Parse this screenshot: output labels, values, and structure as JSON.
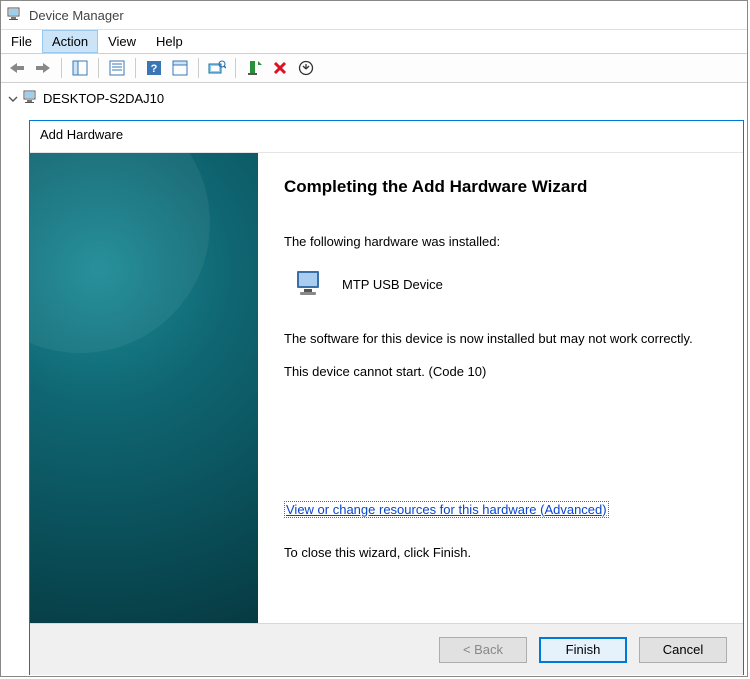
{
  "window": {
    "title": "Device Manager"
  },
  "menu": {
    "file": "File",
    "action": "Action",
    "view": "View",
    "help": "Help"
  },
  "tree": {
    "root": "DESKTOP-S2DAJ10"
  },
  "wizard": {
    "title": "Add Hardware",
    "heading": "Completing the Add Hardware Wizard",
    "installed_label": "The following hardware was installed:",
    "device_name": "MTP USB Device",
    "software_msg": "The software for this device is now installed but may not work correctly.",
    "error_msg": "This device cannot start. (Code 10)",
    "advanced_link": "View or change resources for this hardware (Advanced)",
    "close_msg": "To close this wizard, click Finish.",
    "buttons": {
      "back": "< Back",
      "finish": "Finish",
      "cancel": "Cancel"
    }
  }
}
